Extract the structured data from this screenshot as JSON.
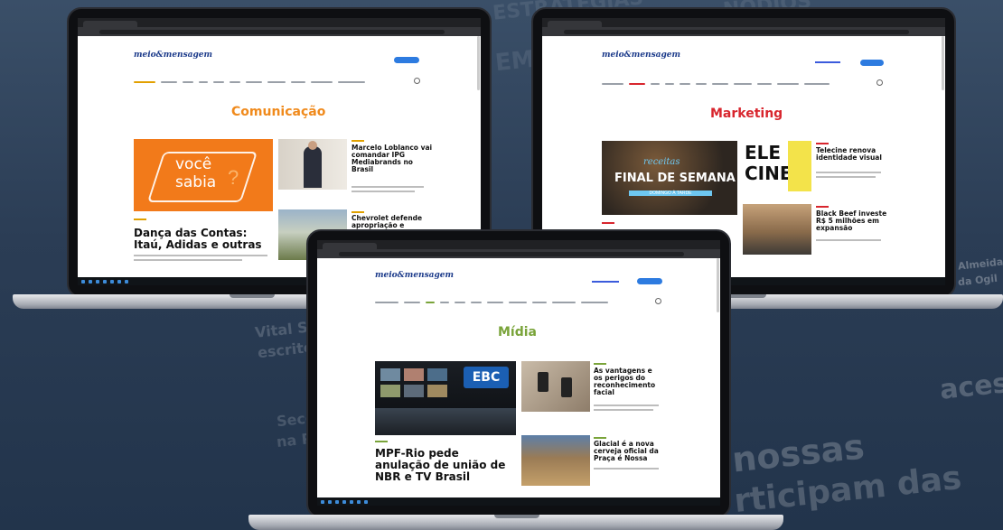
{
  "background": {
    "words": [
      "ESTRATÉGIAS",
      "NÓDIOS",
      "EMP",
      "Vital Str",
      "escritó",
      "Seco",
      "na P",
      "nossas",
      "rticipam das",
      "acess",
      "Almeida",
      "da Ogil"
    ]
  },
  "left_laptop": {
    "logo": "meio&mensagem",
    "section_title": "Comunicação",
    "hero_promo_line1": "você",
    "hero_promo_line2": "sabia",
    "main_headline": "Dança das Contas: Itaú, Adidas e outras",
    "side_story_1": "Marcelo Loblanco vai comandar IPG Mediabrands no Brasil",
    "side_story_2": "Chevrolet defende apropriação e",
    "accent": "#f08a1c"
  },
  "right_laptop": {
    "logo": "meio&mensagem",
    "section_title": "Marketing",
    "hero_caption_1": "receitas",
    "hero_caption_2": "FINAL DE SEMANA",
    "hero_caption_3": "DOMINGO À TARDE",
    "promo_letters": "ELE CINE",
    "side_story_1": "Telecine renova identidade visual",
    "side_story_2": "Black Beef investe R$ 5 milhões em expansão",
    "accent": "#d8262e"
  },
  "center_laptop": {
    "logo": "meio&mensagem",
    "section_title": "Mídia",
    "hero_badge": "EBC",
    "main_headline": "MPF-Rio pede anulação de união de NBR e TV Brasil",
    "side_story_1": "As vantagens e os perigos do reconhecimento facial",
    "side_story_2": "Glacial é a nova cerveja oficial da Praça é Nossa",
    "accent": "#7aa43a"
  }
}
